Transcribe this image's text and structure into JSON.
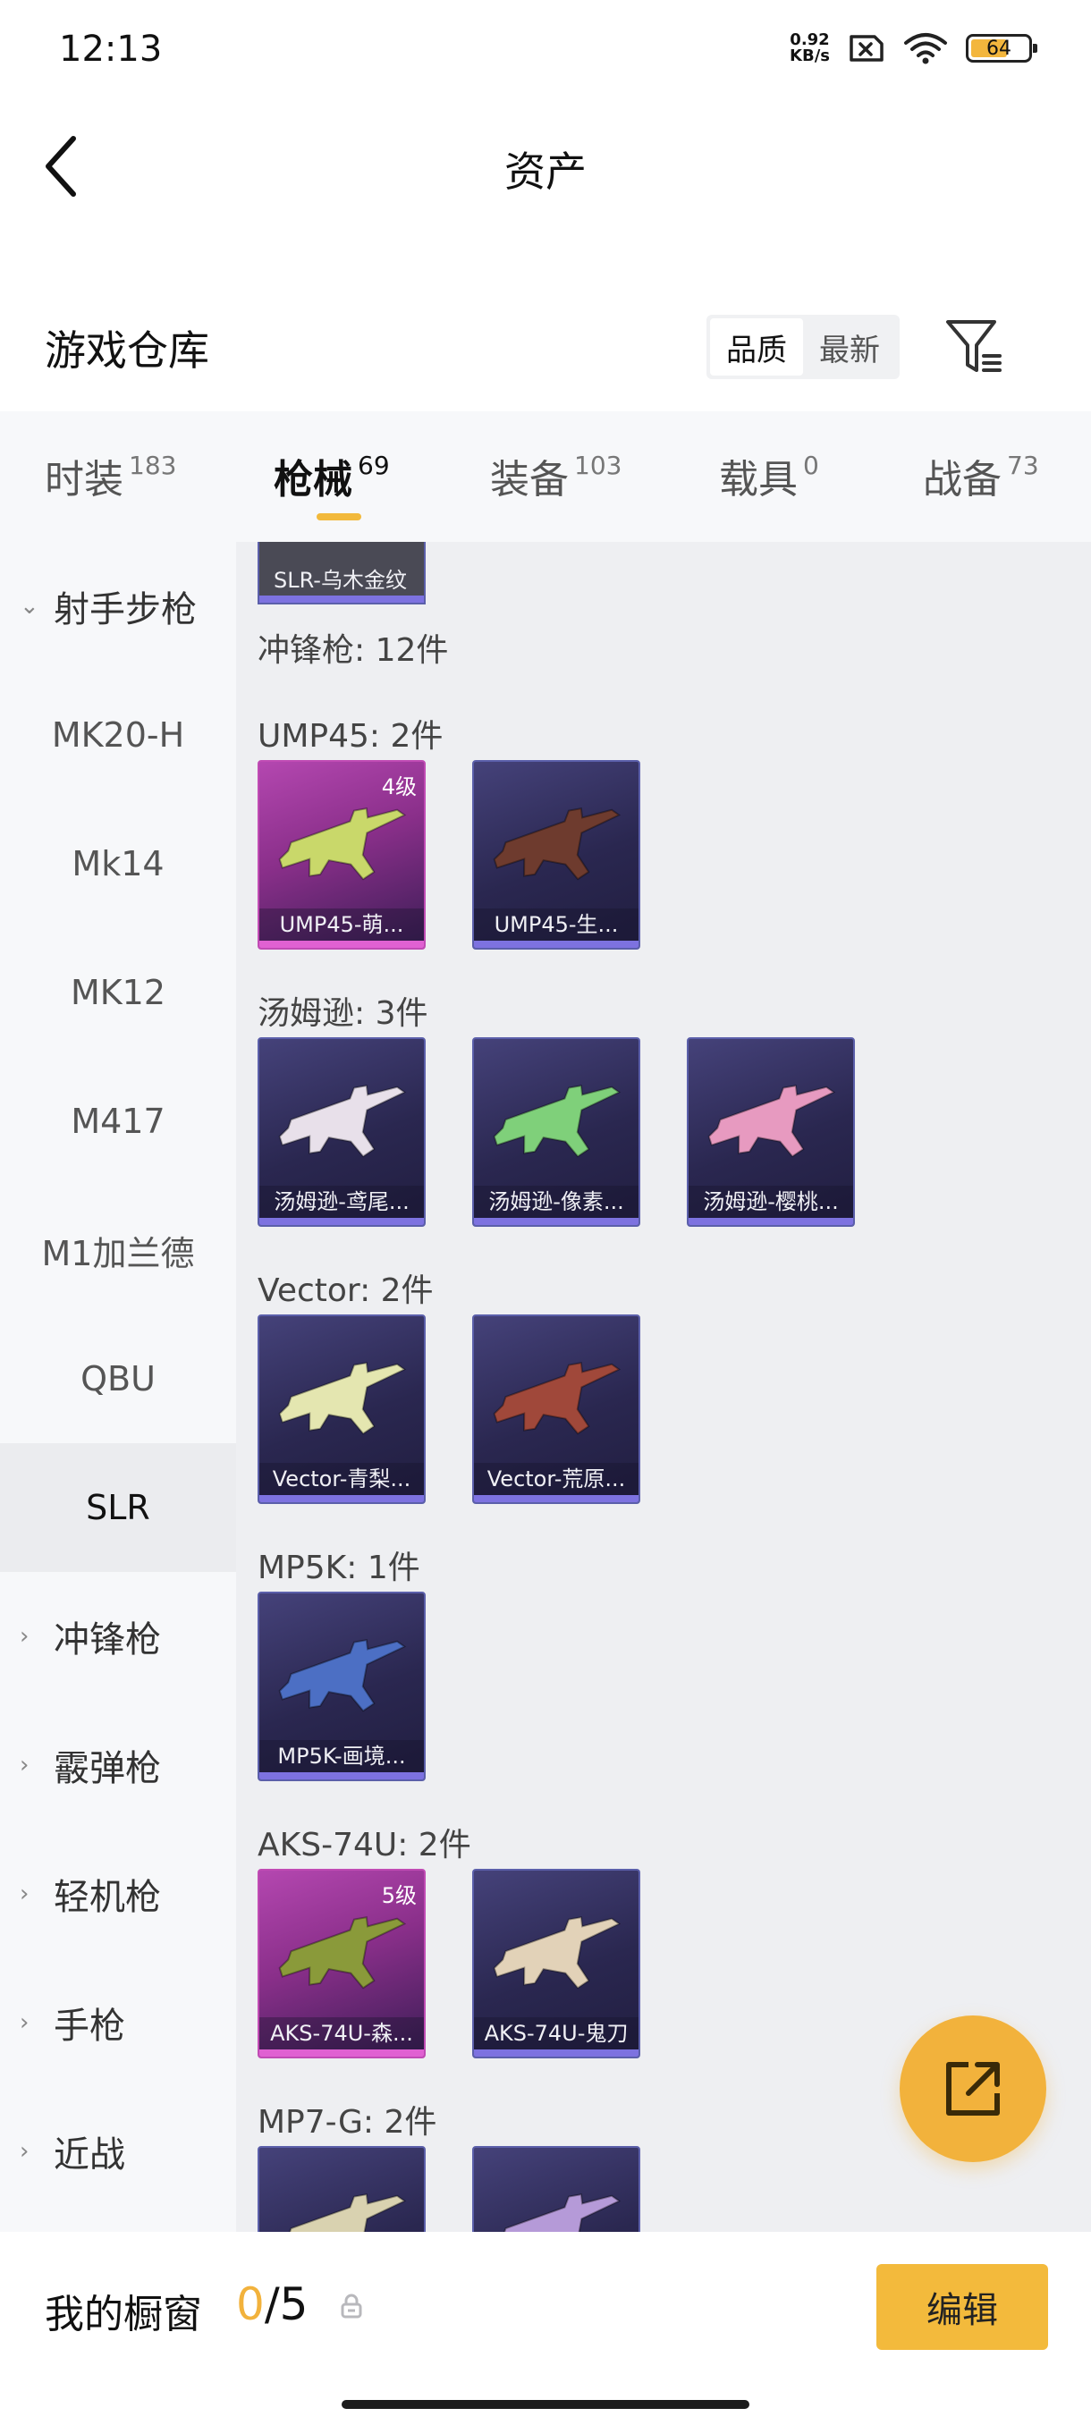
{
  "status_bar": {
    "time": "12:13",
    "net_speed_value": "0.92",
    "net_speed_unit": "KB/s",
    "battery": "64",
    "battery_level": 0.64,
    "icons": [
      "sim-x-icon",
      "wifi-icon",
      "battery-icon"
    ]
  },
  "header": {
    "title": "资产",
    "back_icon": "chevron-left-icon"
  },
  "warehouse": {
    "title": "游戏仓库",
    "sort_options": [
      "品质",
      "最新"
    ],
    "sort_selected": "品质",
    "filter_icon": "filter-icon"
  },
  "tabs": [
    {
      "label": "时装",
      "count": "183"
    },
    {
      "label": "枪械",
      "count": "69",
      "active": true
    },
    {
      "label": "装备",
      "count": "103"
    },
    {
      "label": "载具",
      "count": "0"
    },
    {
      "label": "战备",
      "count": "73"
    }
  ],
  "sidebar": {
    "expanded_category": "射手步枪",
    "sub_items": [
      "MK20-H",
      "Mk14",
      "MK12",
      "M417",
      "M1加兰德",
      "QBU",
      "SLR"
    ],
    "active_sub": "SLR",
    "categories": [
      "冲锋枪",
      "霰弹枪",
      "轻机枪",
      "手枪",
      "近战"
    ]
  },
  "content": {
    "slr_partial_card": "SLR-乌木金纹",
    "category_header": "冲锋枪: 12件",
    "groups": [
      {
        "label": "UMP45: 2件",
        "items": [
          {
            "name": "UMP45-萌...",
            "level": "4级",
            "quality": "pink",
            "gun_color": "#c9d86a"
          },
          {
            "name": "UMP45-生...",
            "level": "",
            "quality": "purple",
            "gun_color": "#6e3b2e"
          }
        ]
      },
      {
        "label": "汤姆逊: 3件",
        "items": [
          {
            "name": "汤姆逊-鸢尾...",
            "level": "",
            "quality": "purple",
            "gun_color": "#e8e0ea"
          },
          {
            "name": "汤姆逊-像素...",
            "level": "",
            "quality": "purple",
            "gun_color": "#7fd07a"
          },
          {
            "name": "汤姆逊-樱桃...",
            "level": "",
            "quality": "purple",
            "gun_color": "#e79ac0"
          }
        ]
      },
      {
        "label": "Vector: 2件",
        "items": [
          {
            "name": "Vector-青梨...",
            "level": "",
            "quality": "purple",
            "gun_color": "#e4e6b0"
          },
          {
            "name": "Vector-荒原...",
            "level": "",
            "quality": "purple",
            "gun_color": "#a0483a"
          }
        ]
      },
      {
        "label": "MP5K: 1件",
        "items": [
          {
            "name": "MP5K-画境...",
            "level": "",
            "quality": "purple",
            "gun_color": "#4c6fc4"
          }
        ]
      },
      {
        "label": "AKS-74U: 2件",
        "items": [
          {
            "name": "AKS-74U-森...",
            "level": "5级",
            "quality": "pink",
            "gun_color": "#8a9a3a"
          },
          {
            "name": "AKS-74U-鬼刀",
            "level": "",
            "quality": "purple",
            "gun_color": "#e2d2b8"
          }
        ]
      },
      {
        "label": "MP7-G: 2件",
        "items": [
          {
            "name": "",
            "level": "",
            "quality": "purple",
            "gun_color": "#d9d2b0"
          },
          {
            "name": "",
            "level": "",
            "quality": "purple",
            "gun_color": "#b59ad8"
          }
        ]
      }
    ]
  },
  "fab": {
    "icon": "share-external-icon"
  },
  "bottom_bar": {
    "title": "我的橱窗",
    "count_current": "0",
    "count_sep": "/",
    "count_total": "5",
    "lock_icon": "lock-icon",
    "edit_label": "编辑"
  },
  "colors": {
    "accent": "#f2b23c",
    "card_purple": "#2a2750",
    "card_pink": "#b447b0"
  }
}
